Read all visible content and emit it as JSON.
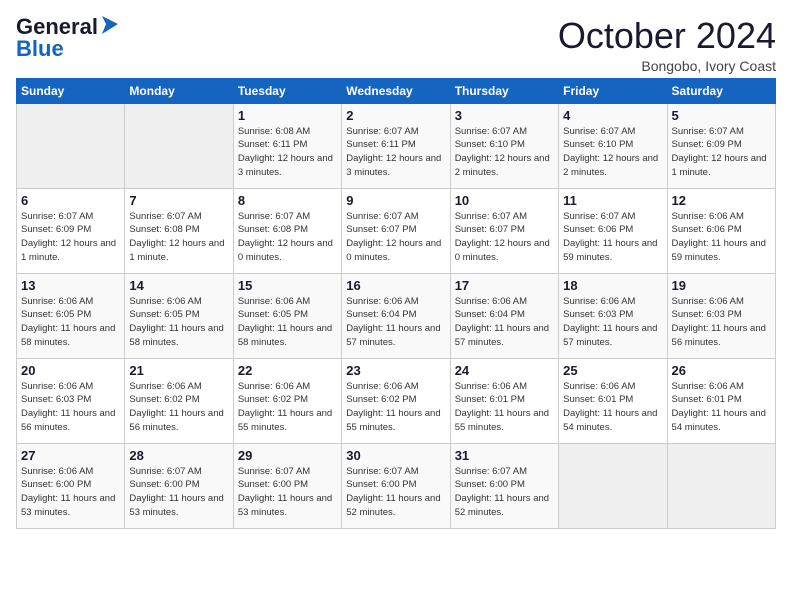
{
  "logo": {
    "line1": "General",
    "line2": "Blue"
  },
  "title": "October 2024",
  "location": "Bongobo, Ivory Coast",
  "weekdays": [
    "Sunday",
    "Monday",
    "Tuesday",
    "Wednesday",
    "Thursday",
    "Friday",
    "Saturday"
  ],
  "weeks": [
    [
      {
        "day": "",
        "detail": ""
      },
      {
        "day": "",
        "detail": ""
      },
      {
        "day": "1",
        "detail": "Sunrise: 6:08 AM\nSunset: 6:11 PM\nDaylight: 12 hours\nand 3 minutes."
      },
      {
        "day": "2",
        "detail": "Sunrise: 6:07 AM\nSunset: 6:11 PM\nDaylight: 12 hours\nand 3 minutes."
      },
      {
        "day": "3",
        "detail": "Sunrise: 6:07 AM\nSunset: 6:10 PM\nDaylight: 12 hours\nand 2 minutes."
      },
      {
        "day": "4",
        "detail": "Sunrise: 6:07 AM\nSunset: 6:10 PM\nDaylight: 12 hours\nand 2 minutes."
      },
      {
        "day": "5",
        "detail": "Sunrise: 6:07 AM\nSunset: 6:09 PM\nDaylight: 12 hours\nand 1 minute."
      }
    ],
    [
      {
        "day": "6",
        "detail": "Sunrise: 6:07 AM\nSunset: 6:09 PM\nDaylight: 12 hours\nand 1 minute."
      },
      {
        "day": "7",
        "detail": "Sunrise: 6:07 AM\nSunset: 6:08 PM\nDaylight: 12 hours\nand 1 minute."
      },
      {
        "day": "8",
        "detail": "Sunrise: 6:07 AM\nSunset: 6:08 PM\nDaylight: 12 hours\nand 0 minutes."
      },
      {
        "day": "9",
        "detail": "Sunrise: 6:07 AM\nSunset: 6:07 PM\nDaylight: 12 hours\nand 0 minutes."
      },
      {
        "day": "10",
        "detail": "Sunrise: 6:07 AM\nSunset: 6:07 PM\nDaylight: 12 hours\nand 0 minutes."
      },
      {
        "day": "11",
        "detail": "Sunrise: 6:07 AM\nSunset: 6:06 PM\nDaylight: 11 hours\nand 59 minutes."
      },
      {
        "day": "12",
        "detail": "Sunrise: 6:06 AM\nSunset: 6:06 PM\nDaylight: 11 hours\nand 59 minutes."
      }
    ],
    [
      {
        "day": "13",
        "detail": "Sunrise: 6:06 AM\nSunset: 6:05 PM\nDaylight: 11 hours\nand 58 minutes."
      },
      {
        "day": "14",
        "detail": "Sunrise: 6:06 AM\nSunset: 6:05 PM\nDaylight: 11 hours\nand 58 minutes."
      },
      {
        "day": "15",
        "detail": "Sunrise: 6:06 AM\nSunset: 6:05 PM\nDaylight: 11 hours\nand 58 minutes."
      },
      {
        "day": "16",
        "detail": "Sunrise: 6:06 AM\nSunset: 6:04 PM\nDaylight: 11 hours\nand 57 minutes."
      },
      {
        "day": "17",
        "detail": "Sunrise: 6:06 AM\nSunset: 6:04 PM\nDaylight: 11 hours\nand 57 minutes."
      },
      {
        "day": "18",
        "detail": "Sunrise: 6:06 AM\nSunset: 6:03 PM\nDaylight: 11 hours\nand 57 minutes."
      },
      {
        "day": "19",
        "detail": "Sunrise: 6:06 AM\nSunset: 6:03 PM\nDaylight: 11 hours\nand 56 minutes."
      }
    ],
    [
      {
        "day": "20",
        "detail": "Sunrise: 6:06 AM\nSunset: 6:03 PM\nDaylight: 11 hours\nand 56 minutes."
      },
      {
        "day": "21",
        "detail": "Sunrise: 6:06 AM\nSunset: 6:02 PM\nDaylight: 11 hours\nand 56 minutes."
      },
      {
        "day": "22",
        "detail": "Sunrise: 6:06 AM\nSunset: 6:02 PM\nDaylight: 11 hours\nand 55 minutes."
      },
      {
        "day": "23",
        "detail": "Sunrise: 6:06 AM\nSunset: 6:02 PM\nDaylight: 11 hours\nand 55 minutes."
      },
      {
        "day": "24",
        "detail": "Sunrise: 6:06 AM\nSunset: 6:01 PM\nDaylight: 11 hours\nand 55 minutes."
      },
      {
        "day": "25",
        "detail": "Sunrise: 6:06 AM\nSunset: 6:01 PM\nDaylight: 11 hours\nand 54 minutes."
      },
      {
        "day": "26",
        "detail": "Sunrise: 6:06 AM\nSunset: 6:01 PM\nDaylight: 11 hours\nand 54 minutes."
      }
    ],
    [
      {
        "day": "27",
        "detail": "Sunrise: 6:06 AM\nSunset: 6:00 PM\nDaylight: 11 hours\nand 53 minutes."
      },
      {
        "day": "28",
        "detail": "Sunrise: 6:07 AM\nSunset: 6:00 PM\nDaylight: 11 hours\nand 53 minutes."
      },
      {
        "day": "29",
        "detail": "Sunrise: 6:07 AM\nSunset: 6:00 PM\nDaylight: 11 hours\nand 53 minutes."
      },
      {
        "day": "30",
        "detail": "Sunrise: 6:07 AM\nSunset: 6:00 PM\nDaylight: 11 hours\nand 52 minutes."
      },
      {
        "day": "31",
        "detail": "Sunrise: 6:07 AM\nSunset: 6:00 PM\nDaylight: 11 hours\nand 52 minutes."
      },
      {
        "day": "",
        "detail": ""
      },
      {
        "day": "",
        "detail": ""
      }
    ]
  ]
}
